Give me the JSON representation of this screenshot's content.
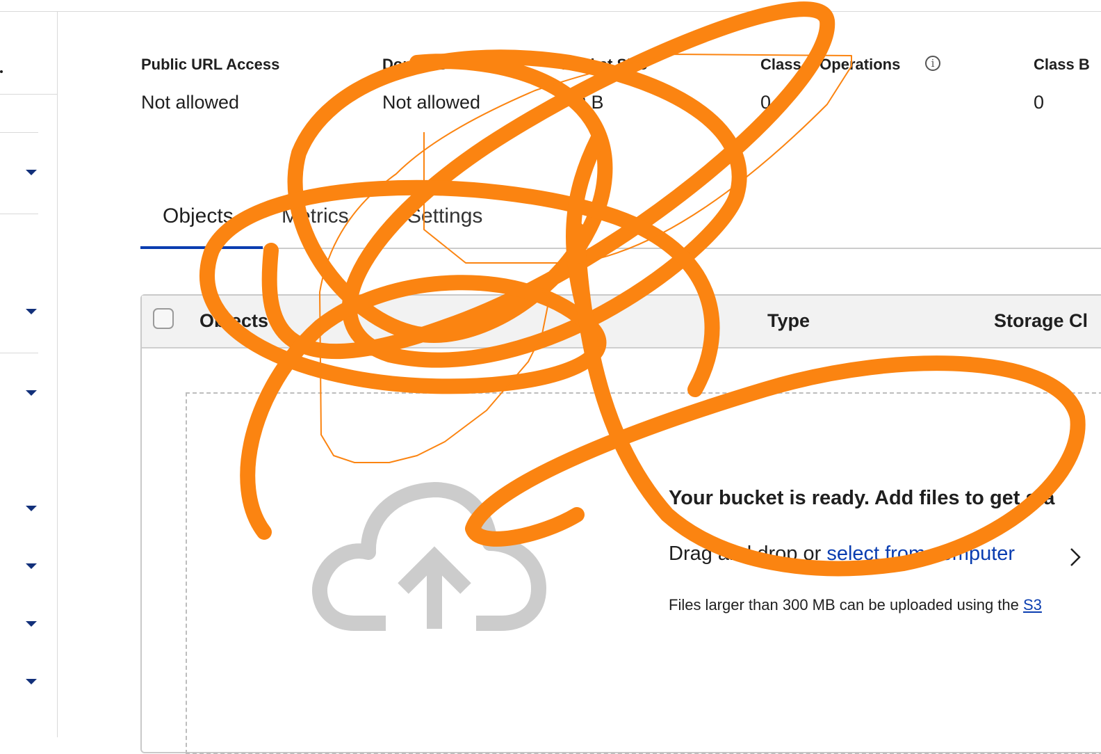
{
  "stats": [
    {
      "label": "Public URL Access",
      "value": "Not allowed"
    },
    {
      "label": "Domains",
      "value": "Not allowed"
    },
    {
      "label": "Bucket Size",
      "value": "0 B"
    },
    {
      "label": "Class A Operations",
      "value": "0"
    },
    {
      "label": "Class B",
      "value": "0"
    }
  ],
  "info_icon": {
    "glyph": "i",
    "name": "info-icon"
  },
  "tabs": [
    {
      "label": "Objects",
      "active": true
    },
    {
      "label": "Metrics"
    },
    {
      "label": "Settings"
    }
  ],
  "table": {
    "columns": [
      "Objects",
      "Type",
      "Storage Cl"
    ]
  },
  "empty_state": {
    "title": "Your bucket is ready. Add files to get sta",
    "drag_prefix": "Drag and drop or ",
    "select_link": "select from computer",
    "files_note": "Files larger than 300 MB can be uploaded using the ",
    "files_link": "S3"
  },
  "colors": {
    "accent": "#0a3db0",
    "annotation": "#fb8411",
    "sidebar_caret": "#12307a"
  }
}
